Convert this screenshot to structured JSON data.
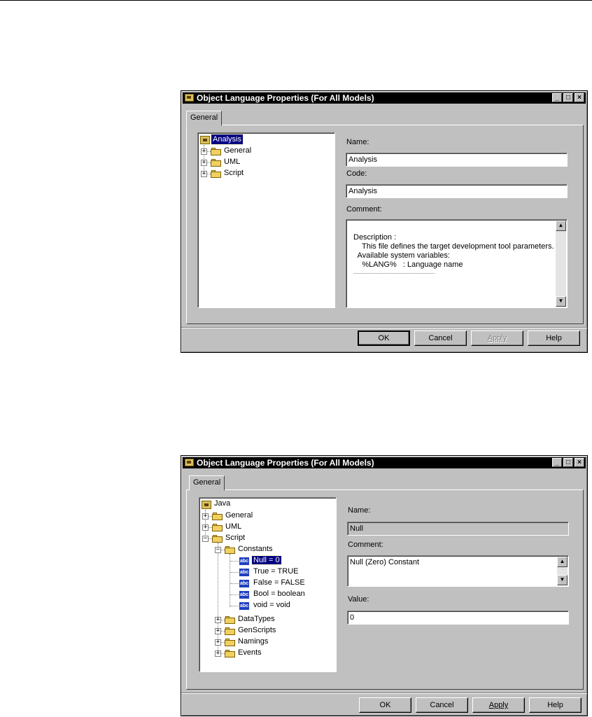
{
  "dialog1": {
    "title": "Object Language Properties (For All Models)",
    "tab": "General",
    "tree": {
      "root": "Analysis",
      "children": [
        "General",
        "UML",
        "Script"
      ]
    },
    "name_label": "Name:",
    "name_value": "Analysis",
    "code_label": "Code:",
    "code_value": "Analysis",
    "comment_label": "Comment:",
    "comment_lines": [
      "Description :",
      "    This file defines the target development tool parameters.",
      "  Available system variables:",
      "    %LANG%   : Language name",
      "----------------------------------------------------------------------"
    ],
    "buttons": {
      "ok": "OK",
      "cancel": "Cancel",
      "apply": "Apply",
      "help": "Help"
    }
  },
  "dialog2": {
    "title": "Object Language Properties (For All Models)",
    "tab": "General",
    "tree": {
      "root": "Java",
      "general": "General",
      "uml": "UML",
      "script": "Script",
      "constants": "Constants",
      "constant_items": [
        "Null = 0",
        "True = TRUE",
        "False = FALSE",
        "Bool = boolean",
        "void = void"
      ],
      "after": [
        "DataTypes",
        "GenScripts",
        "Namings",
        "Events"
      ]
    },
    "name_label": "Name:",
    "name_value": "Null",
    "comment_label": "Comment:",
    "comment_value": "Null (Zero) Constant",
    "value_label": "Value:",
    "value_value": "0",
    "buttons": {
      "ok": "OK",
      "cancel": "Cancel",
      "apply": "Apply",
      "help": "Help"
    }
  },
  "icons": {
    "folder": "folder-icon",
    "constant": "abc-icon",
    "root": "language-icon"
  }
}
